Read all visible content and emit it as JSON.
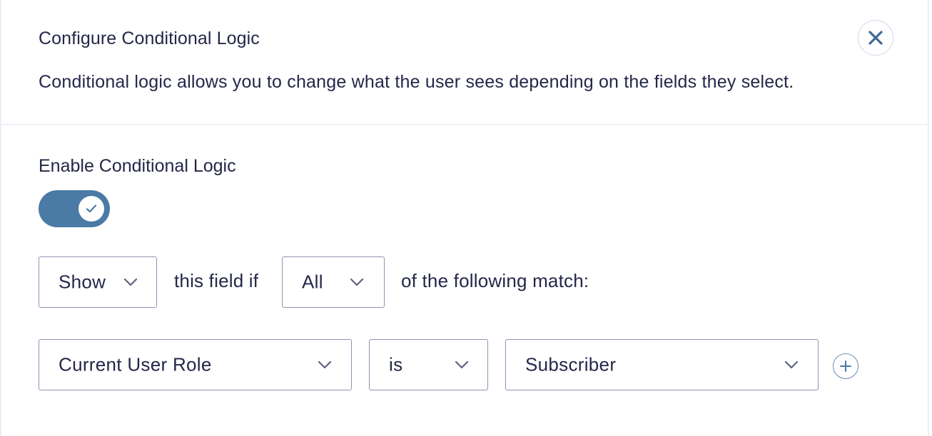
{
  "header": {
    "title": "Configure Conditional Logic",
    "description": "Conditional logic allows you to change what the user sees depending on the fields they select.",
    "close_icon": "close-icon"
  },
  "enable": {
    "label": "Enable Conditional Logic",
    "toggle_on": true,
    "toggle_color": "#4a7aa5"
  },
  "logic_row": {
    "action_select": "Show",
    "text_between": "this field if",
    "match_select": "All",
    "text_after": "of the following match:"
  },
  "rule": {
    "field_select": "Current User Role",
    "operator_select": "is",
    "value_select": "Subscriber",
    "add_icon": "plus-circle-icon"
  }
}
